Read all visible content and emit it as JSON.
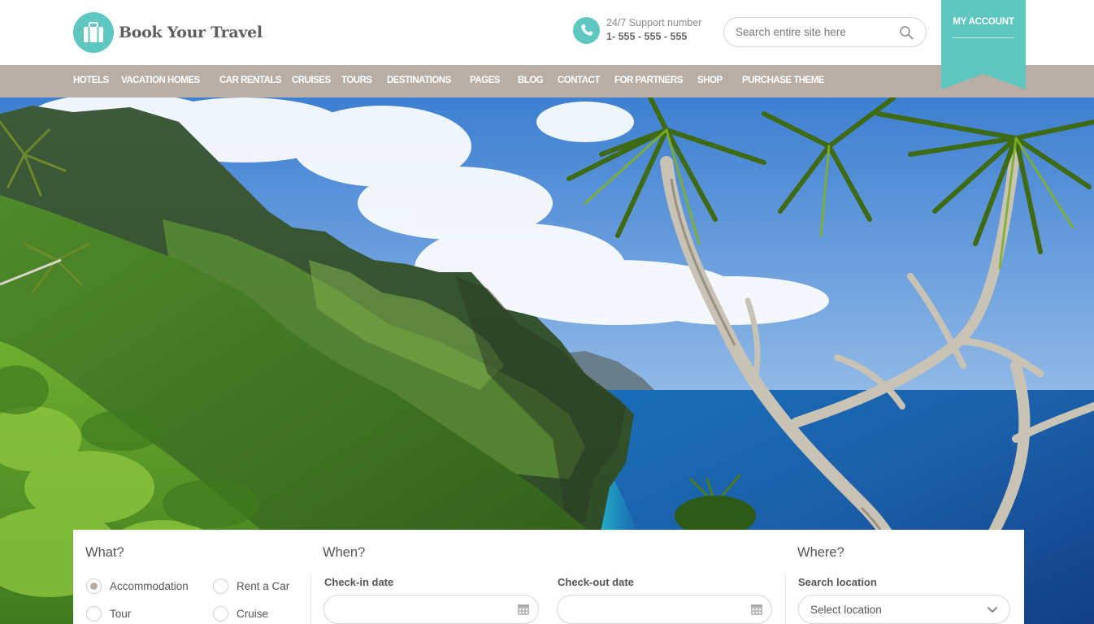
{
  "header": {
    "logo_text": "Book Your Travel",
    "support_label": "24/7 Support number",
    "support_number": "1- 555 - 555 - 555",
    "search_placeholder": "Search entire site here",
    "account_label": "MY ACCOUNT"
  },
  "nav": {
    "items": [
      {
        "label": "HOTELS"
      },
      {
        "label": "VACATION HOMES"
      },
      {
        "label": "CAR RENTALS"
      },
      {
        "label": "CRUISES"
      },
      {
        "label": "TOURS"
      },
      {
        "label": "DESTINATIONS"
      },
      {
        "label": "PAGES"
      },
      {
        "label": "BLOG"
      },
      {
        "label": "CONTACT"
      },
      {
        "label": "FOR PARTNERS"
      },
      {
        "label": "SHOP"
      },
      {
        "label": "PURCHASE THEME"
      }
    ]
  },
  "search_form": {
    "what_title": "What?",
    "when_title": "When?",
    "where_title": "Where?",
    "types": [
      {
        "label": "Accommodation",
        "checked": true
      },
      {
        "label": "Rent a Car",
        "checked": false
      },
      {
        "label": "Tour",
        "checked": false
      },
      {
        "label": "Cruise",
        "checked": false
      }
    ],
    "checkin_label": "Check-in date",
    "checkout_label": "Check-out date",
    "checkin_value": "",
    "checkout_value": "",
    "location_label": "Search location",
    "location_value": "Select location"
  },
  "colors": {
    "accent": "#5ec7bf",
    "nav_bg": "#b9aea5",
    "text": "#555555"
  },
  "icons": {
    "logo": "suitcase-icon",
    "support": "phone-icon",
    "search": "search-icon",
    "date": "calendar-icon",
    "select": "chevron-down-icon"
  }
}
